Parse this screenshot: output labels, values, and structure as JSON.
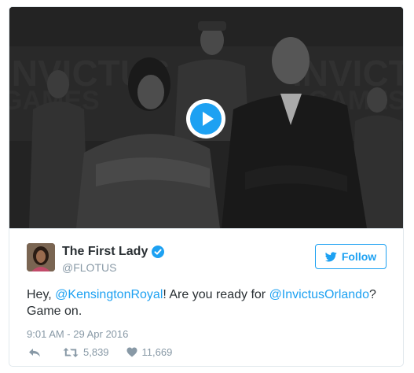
{
  "media": {
    "backdrop_text": "INVICTUS GAMES",
    "play_button_label": "Play video"
  },
  "author": {
    "display_name": "The First Lady",
    "handle": "@FLOTUS",
    "verified": true
  },
  "follow_button": {
    "label": "Follow"
  },
  "tweet": {
    "text_parts": {
      "p0": "Hey, ",
      "m1": "@KensingtonRoyal",
      "p1": "! Are you ready for ",
      "m2": "@InvictusOrlando",
      "p2": "?",
      "p3": "Game on."
    },
    "timestamp": "9:01 AM - 29 Apr 2016"
  },
  "actions": {
    "reply_icon": "reply-icon",
    "retweet_count": "5,839",
    "like_count": "11,669"
  },
  "colors": {
    "accent": "#1da1f2",
    "muted": "#8899a6",
    "text": "#292f33"
  }
}
